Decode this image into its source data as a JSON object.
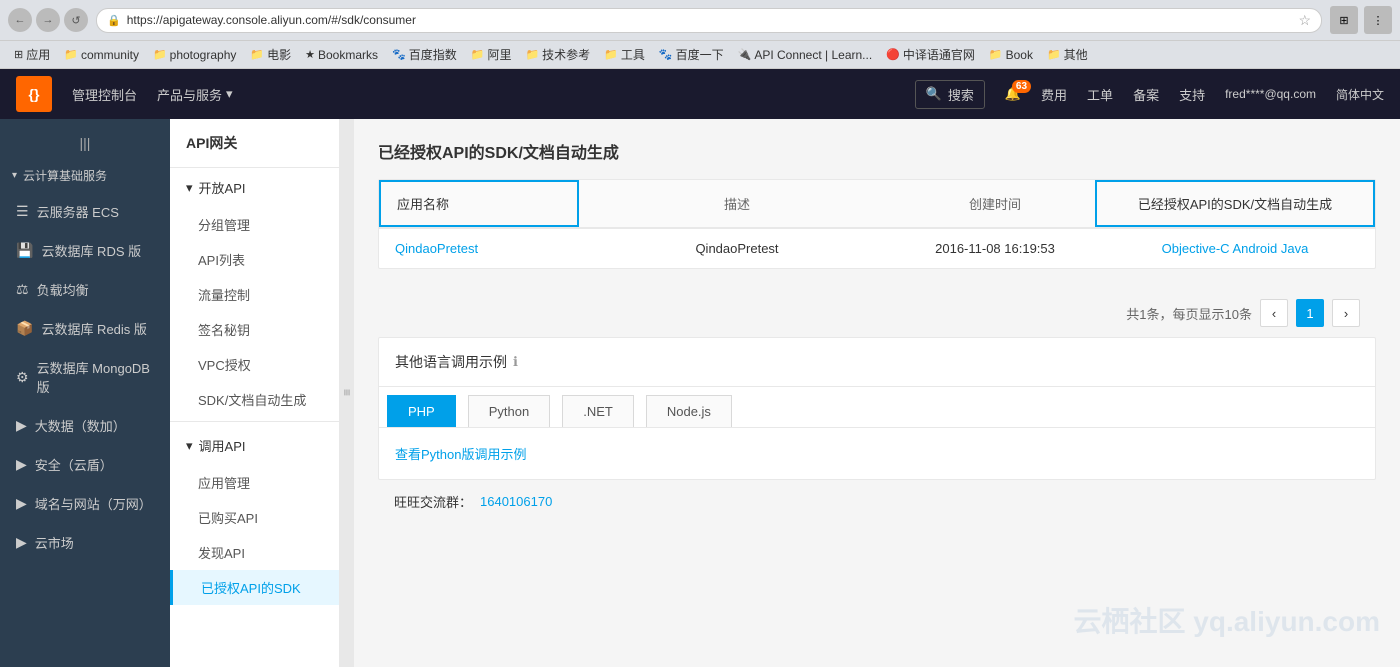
{
  "browser": {
    "nav_back": "←",
    "nav_forward": "→",
    "nav_refresh": "↺",
    "lock_icon": "🔒",
    "url": "https://apigateway.console.aliyun.com/#/sdk/consumer",
    "star": "☆",
    "apps_label": "应用"
  },
  "bookmarks": [
    {
      "id": "community",
      "icon": "📁",
      "label": "community"
    },
    {
      "id": "photography",
      "icon": "📁",
      "label": "photography"
    },
    {
      "id": "movies",
      "icon": "📁",
      "label": "电影"
    },
    {
      "id": "bookmarks",
      "icon": "★",
      "label": "Bookmarks"
    },
    {
      "id": "baidu-index",
      "icon": "🐾",
      "label": "百度指数"
    },
    {
      "id": "ali",
      "icon": "📁",
      "label": "阿里"
    },
    {
      "id": "tech-ref",
      "icon": "📁",
      "label": "技术参考"
    },
    {
      "id": "tools",
      "icon": "📁",
      "label": "工具"
    },
    {
      "id": "baidu-down",
      "icon": "🐾",
      "label": "百度一下"
    },
    {
      "id": "api-connect",
      "icon": "🔌",
      "label": "API Connect | Learn..."
    },
    {
      "id": "translator",
      "icon": "🔴",
      "label": "中译语通官网"
    },
    {
      "id": "book",
      "icon": "📁",
      "label": "Book"
    },
    {
      "id": "other",
      "icon": "📁",
      "label": "其他"
    }
  ],
  "topnav": {
    "logo": "{}",
    "console_label": "管理控制台",
    "products_label": "产品与服务",
    "products_arrow": "▾",
    "search_label": "搜索",
    "search_icon": "🔍",
    "notification_icon": "🔔",
    "notification_count": "63",
    "cost_label": "费用",
    "work_order_label": "工单",
    "backup_label": "备案",
    "support_label": "支持",
    "user_label": "fred****@qq.com",
    "lang_label": "简体中文"
  },
  "left_sidebar": {
    "collapse_icon": "|||",
    "section_label": "云计算基础服务",
    "section_arrow": "▾",
    "items": [
      {
        "id": "ecs",
        "icon": "☰",
        "label": "云服务器 ECS"
      },
      {
        "id": "rds",
        "icon": "💾",
        "label": "云数据库 RDS 版"
      },
      {
        "id": "slb",
        "icon": "⚖",
        "label": "负载均衡"
      },
      {
        "id": "redis",
        "icon": "📦",
        "label": "云数据库 Redis 版"
      },
      {
        "id": "mongodb",
        "icon": "⚙",
        "label": "云数据库 MongoDB 版"
      },
      {
        "id": "bigdata",
        "icon": "▶",
        "label": "大数据（数加）"
      },
      {
        "id": "security",
        "icon": "▶",
        "label": "安全（云盾）"
      },
      {
        "id": "domain",
        "icon": "▶",
        "label": "域名与网站（万网）"
      },
      {
        "id": "market",
        "icon": "▶",
        "label": "云市场"
      }
    ]
  },
  "secondary_sidebar": {
    "title": "API网关",
    "open_api_section": "开放API",
    "open_api_arrow": "▾",
    "open_api_items": [
      {
        "id": "group-mgmt",
        "label": "分组管理"
      },
      {
        "id": "api-list",
        "label": "API列表"
      },
      {
        "id": "flow-control",
        "label": "流量控制"
      },
      {
        "id": "sign-key",
        "label": "签名秘钥"
      },
      {
        "id": "vpc-auth",
        "label": "VPC授权"
      },
      {
        "id": "sdk-doc",
        "label": "SDK/文档自动生成"
      }
    ],
    "call_api_section": "调用API",
    "call_api_arrow": "▾",
    "call_api_items": [
      {
        "id": "app-mgmt",
        "label": "应用管理"
      },
      {
        "id": "purchased-api",
        "label": "已购买API"
      },
      {
        "id": "discover-api",
        "label": "发现API"
      },
      {
        "id": "authorized-sdk",
        "label": "已授权API的SDK",
        "active": true
      }
    ]
  },
  "main": {
    "page_title": "已经授权API的SDK/文档自动生成",
    "table": {
      "col_app": "应用名称",
      "col_desc": "描述",
      "col_time": "创建时间",
      "col_sdk": "已经授权API的SDK/文档自动生成",
      "rows": [
        {
          "app_name": "QindaoPretest",
          "desc": "QindaoPretest",
          "time": "2016-11-08 16:19:53",
          "sdk_links": "Objective-C Android Java"
        }
      ]
    },
    "pagination": {
      "summary": "共1条，每页显示10条",
      "prev": "‹",
      "current_page": "1",
      "next": "›"
    },
    "other_section": {
      "title": "其他语言调用示例",
      "info_icon": "ℹ",
      "tabs": [
        {
          "id": "php",
          "label": "PHP",
          "active": true
        },
        {
          "id": "python",
          "label": "Python",
          "active": false
        },
        {
          "id": "dotnet",
          "label": ".NET",
          "active": false
        },
        {
          "id": "nodejs",
          "label": "Node.js",
          "active": false
        }
      ],
      "content_link": "查看Python版调用示例"
    },
    "wangwang": {
      "label": "旺旺交流群：",
      "value": "1640106170"
    }
  },
  "watermark": "云栖社区 yq.aliyun.com"
}
